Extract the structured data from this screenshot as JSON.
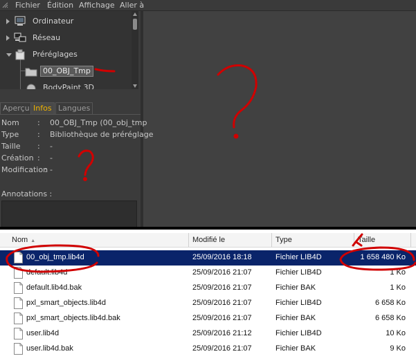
{
  "menu": {
    "items": [
      "Fichier",
      "Édition",
      "Affichage",
      "Aller à"
    ]
  },
  "tree": {
    "nodes": [
      {
        "label": "Ordinateur"
      },
      {
        "label": "Réseau"
      },
      {
        "label": "Préréglages"
      },
      {
        "label": "00_OBJ_Tmp"
      },
      {
        "label": "BodyPaint 3D"
      }
    ]
  },
  "tabs": [
    "Aperçu",
    "Infos",
    "Langues"
  ],
  "info": {
    "rows": [
      {
        "key": "Nom",
        "value": "00_OBJ_Tmp (00_obj_tmp"
      },
      {
        "key": "Type",
        "value": "Bibliothèque de préréglage"
      },
      {
        "key": "Taille",
        "value": "-"
      },
      {
        "key": "Création",
        "value": "-"
      },
      {
        "key": "Modification",
        "value": "-"
      }
    ],
    "annotations_label": "Annotations :"
  },
  "explorer": {
    "columns": [
      "Nom",
      "Modifié le",
      "Type",
      "Taille"
    ],
    "files": [
      {
        "name": "00_obj_tmp.lib4d",
        "modified": "25/09/2016 18:18",
        "type": "Fichier LIB4D",
        "size": "1 658 480 Ko"
      },
      {
        "name": "default.lib4d",
        "modified": "25/09/2016 21:07",
        "type": "Fichier LIB4D",
        "size": "1 Ko"
      },
      {
        "name": "default.lib4d.bak",
        "modified": "25/09/2016 21:07",
        "type": "Fichier BAK",
        "size": "1 Ko"
      },
      {
        "name": "pxl_smart_objects.lib4d",
        "modified": "25/09/2016 21:07",
        "type": "Fichier LIB4D",
        "size": "6 658 Ko"
      },
      {
        "name": "pxl_smart_objects.lib4d.bak",
        "modified": "25/09/2016 21:07",
        "type": "Fichier BAK",
        "size": "6 658 Ko"
      },
      {
        "name": "user.lib4d",
        "modified": "25/09/2016 21:12",
        "type": "Fichier LIB4D",
        "size": "10 Ko"
      },
      {
        "name": "user.lib4d.bak",
        "modified": "25/09/2016 21:07",
        "type": "Fichier BAK",
        "size": "9 Ko"
      }
    ]
  },
  "colors": {
    "accent_tab": "#f0b400",
    "selection": "#0a246a",
    "annotation": "#d00000"
  }
}
